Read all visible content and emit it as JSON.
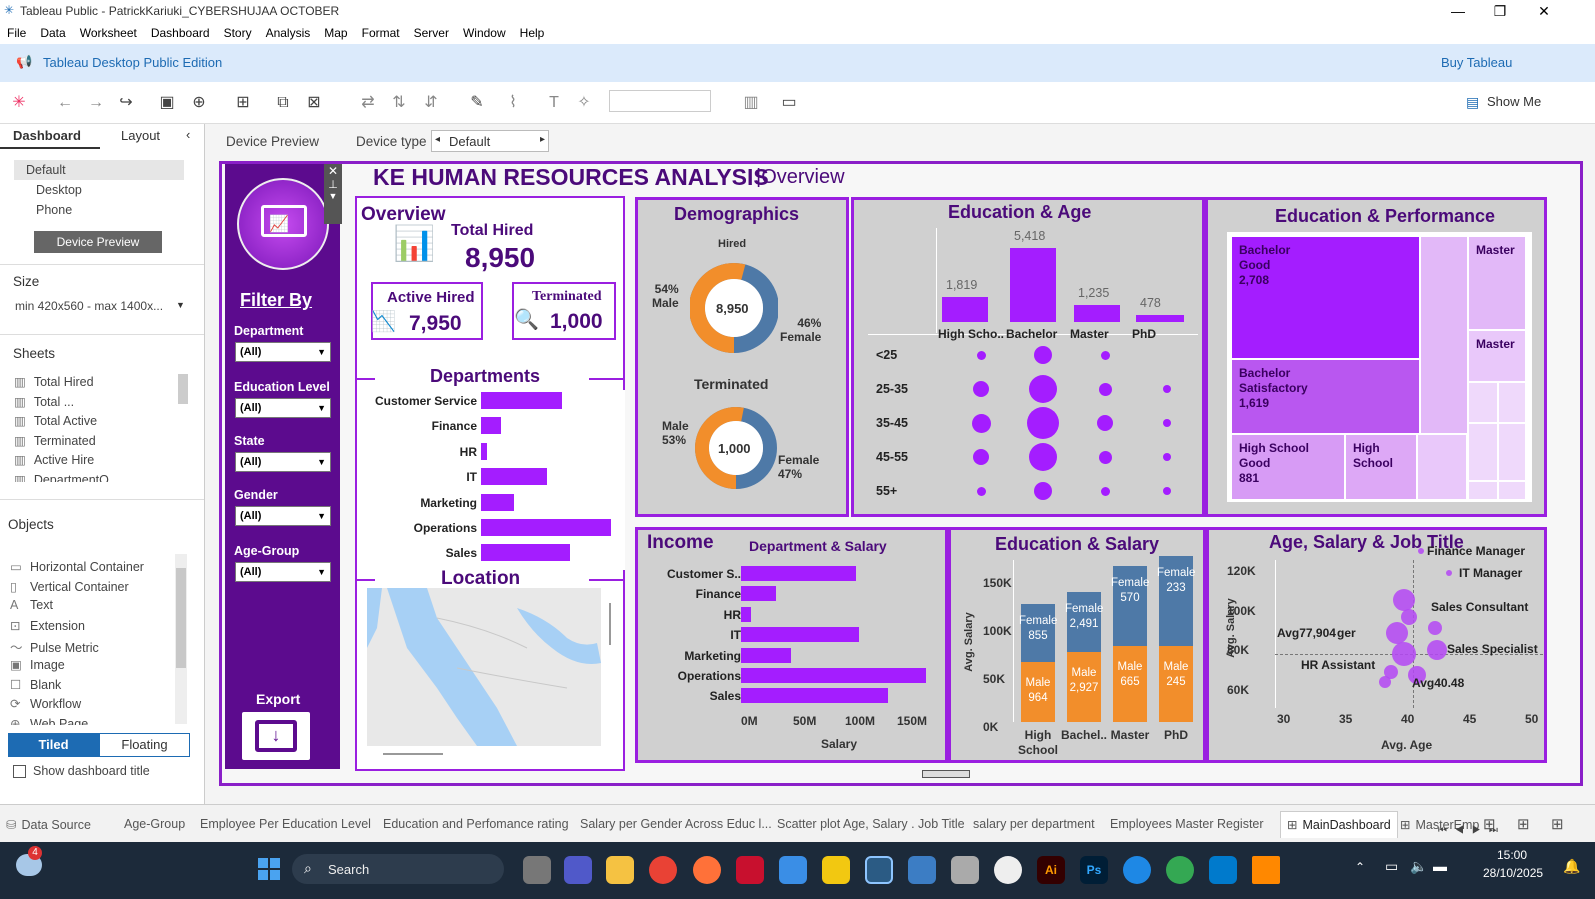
{
  "window": {
    "title": "Tableau Public - PatrickKariuki_CYBERSHUJAA OCTOBER"
  },
  "menu": [
    "File",
    "Data",
    "Worksheet",
    "Dashboard",
    "Story",
    "Analysis",
    "Map",
    "Format",
    "Server",
    "Window",
    "Help"
  ],
  "banner": {
    "edition": "Tableau Desktop Public Edition",
    "buy": "Buy Tableau"
  },
  "toolbar": {
    "show_me": "Show Me"
  },
  "left": {
    "tab_dashboard": "Dashboard",
    "tab_layout": "Layout",
    "devices": [
      "Default",
      "Desktop",
      "Phone"
    ],
    "device_preview_btn": "Device Preview",
    "size_label": "Size",
    "size_value": "min 420x560 - max 1400x...",
    "sheets_label": "Sheets",
    "sheets": [
      "Total Hired",
      "Total ...",
      "Total Active",
      "Terminated",
      "Active Hire",
      "DepartmentO..."
    ],
    "objects_label": "Objects",
    "objects": [
      "Horizontal Container",
      "Vertical Container",
      "Text",
      "Extension",
      "Pulse Metric",
      "Image",
      "Blank",
      "Workflow",
      "Web Page"
    ],
    "tiled": "Tiled",
    "floating": "Floating",
    "show_title": "Show dashboard title"
  },
  "canvas_bar": {
    "device_preview": "Device Preview",
    "device_type": "Device type",
    "device_value": "Default"
  },
  "dashboard": {
    "title": "KE HUMAN RESOURCES ANALYSIS",
    "subtitle": "|Overview",
    "filter": {
      "title": "Filter By",
      "fields": [
        {
          "label": "Department",
          "value": "(All)"
        },
        {
          "label": "Education Level",
          "value": "(All)"
        },
        {
          "label": "State",
          "value": "(All)"
        },
        {
          "label": "Gender",
          "value": "(All)"
        },
        {
          "label": "Age-Group",
          "value": "(All)"
        }
      ],
      "export": "Export"
    },
    "overview": {
      "title": "Overview",
      "total_label": "Total Hired",
      "total": "8,950",
      "active_label": "Active Hired",
      "active": "7,950",
      "term_label": "Terminated",
      "term": "1,000"
    },
    "departments": {
      "title": "Departments",
      "items": [
        "Customer Service",
        "Finance",
        "HR",
        "IT",
        "Marketing",
        "Operations",
        "Sales"
      ],
      "values": [
        65,
        16,
        5,
        53,
        27,
        105,
        72
      ]
    },
    "location": {
      "title": "Location"
    },
    "demographics": {
      "title": "Demographics",
      "hired_label": "Hired",
      "hired_total": "8,950",
      "hired_male": "54%\nMale",
      "hired_female": "46%\nFemale",
      "hired_male_pct": 54,
      "term_label": "Terminated",
      "term_total": "1,000",
      "term_male": "Male\n53%",
      "term_female": "Female\n47%",
      "term_male_pct": 53
    },
    "edu_age": {
      "title": "Education & Age",
      "bars": [
        {
          "label": "High Scho..",
          "value": "1,819",
          "v": 1819
        },
        {
          "label": "Bachelor",
          "value": "5,418",
          "v": 5418
        },
        {
          "label": "Master",
          "value": "1,235",
          "v": 1235
        },
        {
          "label": "PhD",
          "value": "478",
          "v": 478
        }
      ],
      "age_groups": [
        "<25",
        "25-35",
        "35-45",
        "45-55",
        "55+"
      ]
    },
    "edu_perf": {
      "title": "Education & Performance",
      "cells": [
        {
          "l1": "Bachelor",
          "l2": "Good",
          "l3": "2,708"
        },
        {
          "l1": "Bachelor",
          "l2": "Satisfactory",
          "l3": "1,619"
        },
        {
          "l1": "High School",
          "l2": "Good",
          "l3": "881"
        },
        {
          "l1": "High",
          "l2": "School",
          "l3": ""
        },
        {
          "l1": "Master",
          "l2": "",
          "l3": ""
        },
        {
          "l1": "Master",
          "l2": "",
          "l3": ""
        }
      ]
    },
    "income": {
      "title": "Income",
      "sub": "Department & Salary",
      "items": [
        "Customer S..",
        "Finance",
        "HR",
        "IT",
        "Marketing",
        "Operations",
        "Sales"
      ],
      "values": [
        115,
        35,
        10,
        118,
        50,
        185,
        147
      ],
      "ticks": [
        "0M",
        "50M",
        "100M",
        "150M"
      ],
      "xlabel": "Salary"
    },
    "edu_salary": {
      "title": "Education & Salary",
      "ylabel": "Avg. Salary",
      "yticks": [
        "150K",
        "100K",
        "50K",
        "0K"
      ],
      "cats": [
        "High\nSchool",
        "Bachel..",
        "Master",
        "PhD"
      ],
      "female": [
        "Female\n855",
        "Female\n2,491",
        "Female\n570",
        "Female\n233"
      ],
      "male": [
        "Male\n964",
        "Male\n2,927",
        "Male\n665",
        "Male\n245"
      ]
    },
    "scatter": {
      "title": "Age, Salary & Job Title",
      "ylabel": "Avg. Salary",
      "xlabel": "Avg. Age",
      "yticks": [
        "120K",
        "100K",
        "80K",
        "60K"
      ],
      "xticks": [
        "30",
        "35",
        "40",
        "45",
        "50"
      ],
      "labels": [
        "Finance Manager",
        "IT Manager",
        "Sales Consultant",
        "Sales Specialist",
        "HR Assistant",
        "Avg77,904",
        "ger",
        "Avg40.48"
      ]
    }
  },
  "sheet_tabs": [
    "Data Source",
    "Age-Group",
    "Employee Per Education Level",
    "Education and Perfomance rating",
    "Salary per Gender Across Educ l...",
    "Scatter plot Age, Salary . Job Title",
    "salary per department",
    "Employees Master Register",
    "MainDashboard",
    "MasterEmp"
  ],
  "taskbar": {
    "search": "Search",
    "time": "15:00",
    "date": "28/10/2025",
    "badge": "4"
  }
}
